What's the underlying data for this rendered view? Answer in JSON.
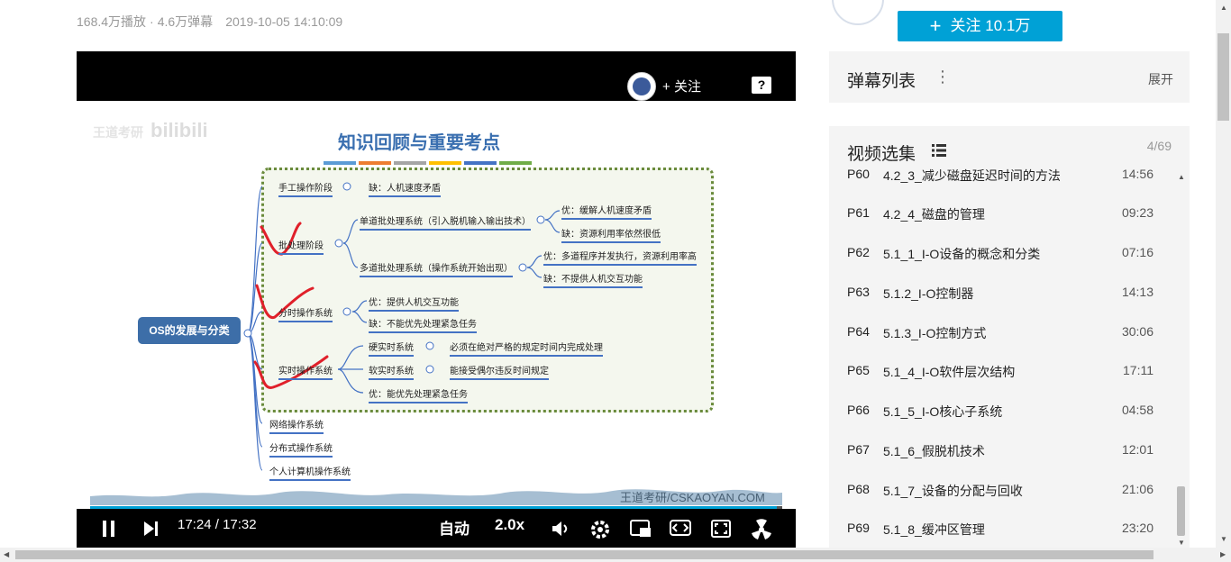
{
  "meta": {
    "plays": "168.4万播放",
    "sep": "·",
    "danmaku": "4.6万弹幕",
    "date": "2019-10-05 14:10:09"
  },
  "player": {
    "follow_label": "关注",
    "help_icon": "?",
    "watermark_left": "王道考研",
    "watermark_logo": "bilibili",
    "watermark_right": "王道考研/CSKAOYAN.COM",
    "current_time": "17:24",
    "time_sep": "/",
    "total_time": "17:32",
    "quality": "自动",
    "speed": "2.0x",
    "progress": 0.992,
    "icons": [
      "pause-icon",
      "next-icon",
      "volume-icon",
      "settings-icon",
      "pip-icon",
      "widescreen-icon",
      "fullscreen-icon",
      "danmaku-toggle-icon"
    ]
  },
  "slide": {
    "title": "知识回顾与重要考点",
    "root": "OS的发展与分类",
    "nodes": {
      "manual": "手工操作阶段",
      "manual_con": "缺：人机速度矛盾",
      "batch": "批处理阶段",
      "single": "单道批处理系统（引入脱机输入输出技术）",
      "single_pro": "优：缓解人机速度矛盾",
      "single_con": "缺：资源利用率依然很低",
      "multi": "多道批处理系统（操作系统开始出现）",
      "multi_pro": "优：多道程序并发执行，资源利用率高",
      "multi_con": "缺：不提供人机交互功能",
      "ts": "分时操作系统",
      "ts_pro": "优：提供人机交互功能",
      "ts_con": "缺：不能优先处理紧急任务",
      "rt": "实时操作系统",
      "hard": "硬实时系统",
      "hard_desc": "必须在绝对严格的规定时间内完成处理",
      "soft": "软实时系统",
      "soft_desc": "能接受偶尔违反时间规定",
      "rt_pro": "优：能优先处理紧急任务",
      "net": "网络操作系统",
      "dist": "分布式操作系统",
      "pc": "个人计算机操作系统"
    },
    "colors": [
      "#5b9bd5",
      "#ed7d31",
      "#a5a5a5",
      "#ffc000",
      "#4472c4",
      "#70ad47"
    ]
  },
  "sidebar": {
    "follow_button": "关注 10.1万",
    "follow_plus": "+",
    "danmaku_title": "弹幕列表",
    "danmaku_more": "⋮",
    "danmaku_expand": "展开",
    "episodes_title": "视频选集",
    "episodes_count": "4/69",
    "episodes": [
      {
        "p": "P60",
        "name": "4.2_3_减少磁盘延迟时间的方法",
        "dur": "14:56"
      },
      {
        "p": "P61",
        "name": "4.2_4_磁盘的管理",
        "dur": "09:23"
      },
      {
        "p": "P62",
        "name": "5.1_1_I-O设备的概念和分类",
        "dur": "07:16"
      },
      {
        "p": "P63",
        "name": "5.1.2_I-O控制器",
        "dur": "14:13"
      },
      {
        "p": "P64",
        "name": "5.1.3_I-O控制方式",
        "dur": "30:06"
      },
      {
        "p": "P65",
        "name": "5.1_4_I-O软件层次结构",
        "dur": "17:11"
      },
      {
        "p": "P66",
        "name": "5.1_5_I-O核心子系统",
        "dur": "04:58"
      },
      {
        "p": "P67",
        "name": "5.1_6_假脱机技术",
        "dur": "12:01"
      },
      {
        "p": "P68",
        "name": "5.1_7_设备的分配与回收",
        "dur": "21:06"
      },
      {
        "p": "P69",
        "name": "5.1_8_缓冲区管理",
        "dur": "23:20"
      }
    ]
  }
}
